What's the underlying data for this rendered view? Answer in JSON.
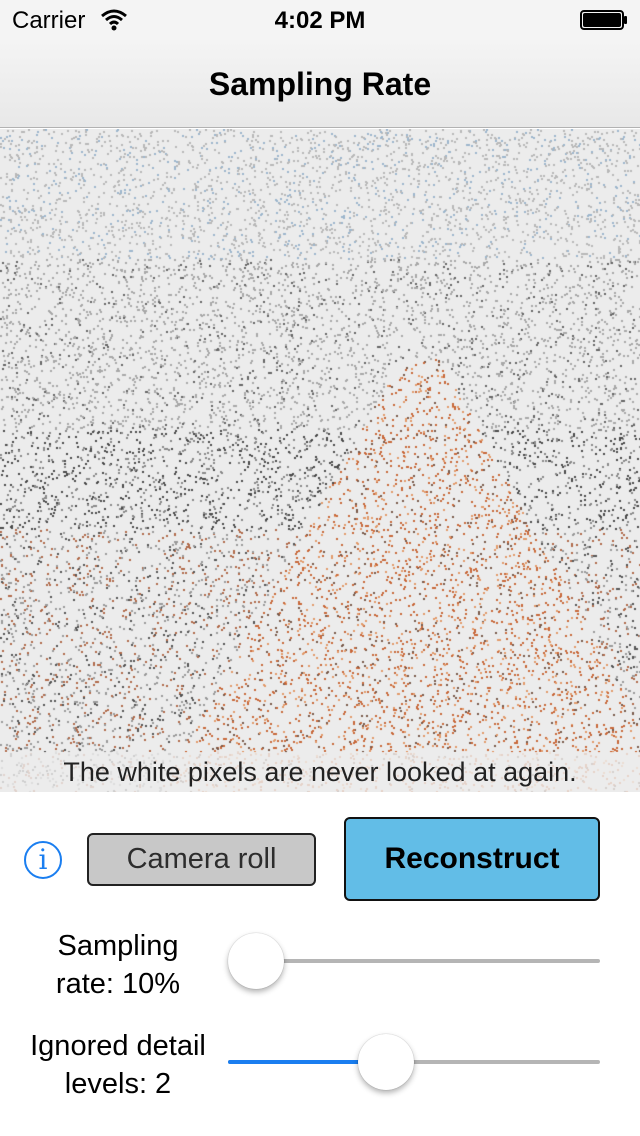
{
  "status_bar": {
    "carrier": "Carrier",
    "time": "4:02 PM"
  },
  "nav": {
    "title": "Sampling Rate"
  },
  "preview": {
    "caption": "The white pixels are never looked at again."
  },
  "controls": {
    "info_label": "i",
    "camera_roll_label": "Camera roll",
    "reconstruct_label": "Reconstruct",
    "accent_color": "#1a7ef0",
    "reconstruct_color": "#62bde7"
  },
  "sampling_rate": {
    "label_line1": "Sampling",
    "label_line2": "rate: 10%",
    "slider_value": 0.0
  },
  "ignored_detail": {
    "label_line1": "Ignored detail",
    "label_line2": "levels: 2",
    "slider_value": 0.41
  }
}
